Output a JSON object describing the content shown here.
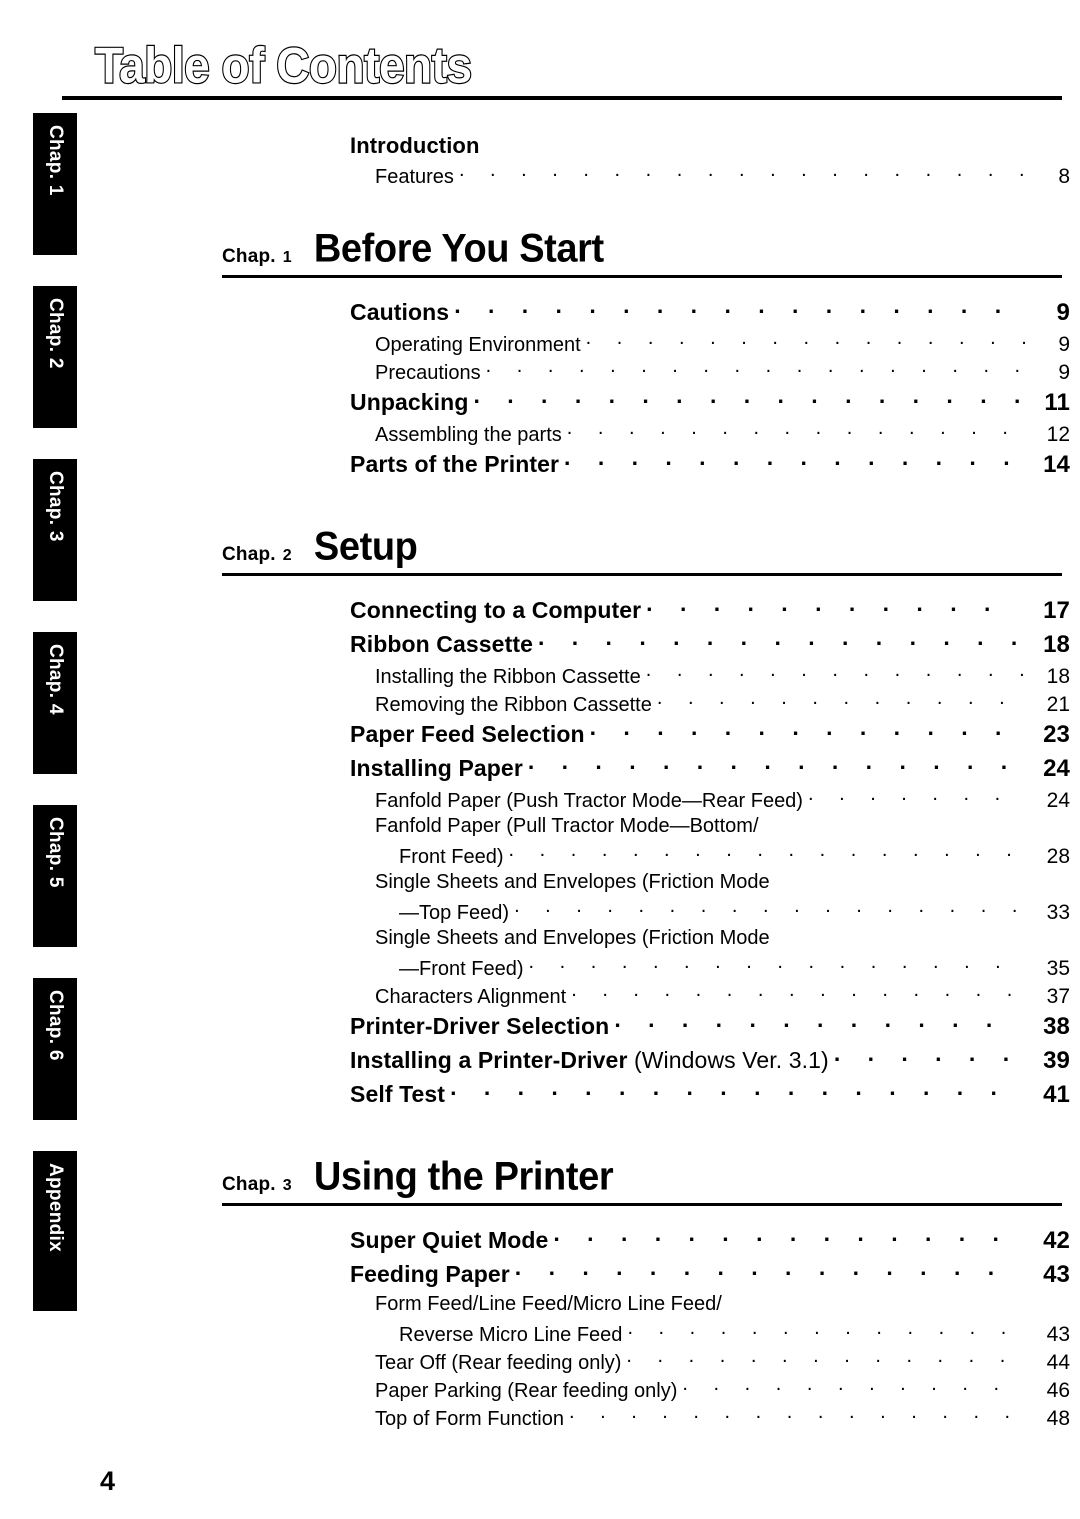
{
  "page": {
    "title": "Table of Contents",
    "folio": "4"
  },
  "side_tabs": [
    {
      "label": "Chap. 1"
    },
    {
      "label": "Chap. 2"
    },
    {
      "label": "Chap. 3"
    },
    {
      "label": "Chap. 4"
    },
    {
      "label": "Chap. 5"
    },
    {
      "label": "Chap. 6"
    },
    {
      "label": "Appendix"
    }
  ],
  "intro": {
    "heading": "Introduction",
    "entry": {
      "title": "Features",
      "page": "8"
    }
  },
  "chapters": [
    {
      "label": "Chap.",
      "number": "1",
      "title": "Before You Start",
      "entries": [
        {
          "level": 1,
          "title": "Cautions",
          "page": "9"
        },
        {
          "level": 2,
          "title": "Operating Environment",
          "page": "9"
        },
        {
          "level": 2,
          "title": "Precautions",
          "page": "9"
        },
        {
          "level": 1,
          "title": "Unpacking",
          "page": "11"
        },
        {
          "level": 2,
          "title": "Assembling the parts",
          "page": "12"
        },
        {
          "level": 1,
          "title": "Parts of the Printer",
          "page": "14"
        }
      ]
    },
    {
      "label": "Chap.",
      "number": "2",
      "title": "Setup",
      "entries": [
        {
          "level": 1,
          "title": "Connecting to a Computer",
          "page": "17"
        },
        {
          "level": 1,
          "title": "Ribbon Cassette",
          "page": "18"
        },
        {
          "level": 2,
          "title": "Installing the Ribbon Cassette",
          "page": "18"
        },
        {
          "level": 2,
          "title": "Removing the Ribbon Cassette",
          "page": "21"
        },
        {
          "level": 1,
          "title": "Paper Feed Selection",
          "page": "23"
        },
        {
          "level": 1,
          "title": "Installing Paper",
          "page": "24"
        },
        {
          "level": 2,
          "title": "Fanfold Paper (Push Tractor Mode—Rear Feed)",
          "page": "24"
        },
        {
          "level": 2,
          "wrap_first": "Fanfold Paper (Pull Tractor Mode—Bottom/",
          "title": "Front Feed)",
          "page": "28"
        },
        {
          "level": 2,
          "wrap_first": "Single Sheets and Envelopes (Friction Mode",
          "title": "—Top Feed)",
          "page": "33"
        },
        {
          "level": 2,
          "wrap_first": "Single Sheets and Envelopes (Friction Mode",
          "title": "—Front Feed)",
          "page": "35"
        },
        {
          "level": 2,
          "title": "Characters Alignment",
          "page": "37"
        },
        {
          "level": 1,
          "title": "Printer-Driver Selection",
          "page": "38"
        },
        {
          "level": 1,
          "title": "Installing a Printer-Driver",
          "title_regular": " (Windows Ver. 3.1)",
          "page": "39"
        },
        {
          "level": 1,
          "title": "Self Test",
          "page": "41"
        }
      ]
    },
    {
      "label": "Chap.",
      "number": "3",
      "title": "Using the Printer",
      "entries": [
        {
          "level": 1,
          "title": "Super Quiet Mode",
          "page": "42"
        },
        {
          "level": 1,
          "title": "Feeding Paper",
          "page": "43"
        },
        {
          "level": 2,
          "wrap_first": "Form Feed/Line Feed/Micro Line Feed/",
          "title": "Reverse Micro Line Feed",
          "page": "43"
        },
        {
          "level": 2,
          "title": "Tear Off (Rear feeding only)",
          "page": "44"
        },
        {
          "level": 2,
          "title": "Paper Parking (Rear feeding only)",
          "page": "46"
        },
        {
          "level": 2,
          "title": "Top of Form Function",
          "page": "48"
        }
      ]
    }
  ]
}
